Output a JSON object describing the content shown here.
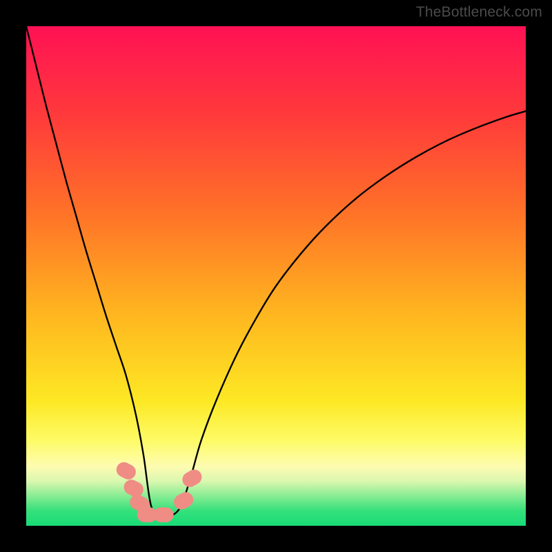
{
  "watermark": "TheBottleneck.com",
  "chart_data": {
    "type": "line",
    "title": "",
    "xlabel": "",
    "ylabel": "",
    "xlim": [
      0,
      100
    ],
    "ylim": [
      0,
      100
    ],
    "grid": false,
    "legend": false,
    "background_gradient_top_to_bottom": [
      {
        "pos": 0.0,
        "color": "#ff1154"
      },
      {
        "pos": 0.18,
        "color": "#ff3a3b"
      },
      {
        "pos": 0.38,
        "color": "#ff7427"
      },
      {
        "pos": 0.58,
        "color": "#ffb71f"
      },
      {
        "pos": 0.75,
        "color": "#fde824"
      },
      {
        "pos": 0.83,
        "color": "#fdfb66"
      },
      {
        "pos": 0.88,
        "color": "#fefcb0"
      },
      {
        "pos": 0.91,
        "color": "#dcf7b0"
      },
      {
        "pos": 0.94,
        "color": "#88ed93"
      },
      {
        "pos": 0.97,
        "color": "#35e07b"
      },
      {
        "pos": 1.0,
        "color": "#18db76"
      }
    ],
    "series": [
      {
        "name": "bottleneck-curve",
        "color": "#000000",
        "width": 2.4,
        "x": [
          0,
          2,
          4,
          6,
          8,
          10,
          12,
          14,
          16,
          18,
          20,
          22,
          23.5,
          25,
          27,
          29,
          31,
          33,
          35,
          38,
          42,
          46,
          50,
          55,
          60,
          66,
          72,
          78,
          84,
          90,
          96,
          100
        ],
        "values": [
          100,
          92,
          84,
          76.5,
          69,
          62,
          55,
          48.5,
          42,
          36,
          30,
          22,
          14,
          4,
          2,
          2,
          4,
          10,
          17,
          25,
          34,
          41.5,
          48,
          54.5,
          60,
          65.5,
          70,
          73.8,
          77,
          79.6,
          81.8,
          83
        ]
      }
    ],
    "markers": {
      "name": "bottom-highlight-dots",
      "shape": "rounded-pill",
      "color": "#ef8d85",
      "points": [
        {
          "x": 20.0,
          "y": 11.0,
          "w": 3.0,
          "h": 4.0,
          "angle": -63
        },
        {
          "x": 21.5,
          "y": 7.5,
          "w": 3.0,
          "h": 4.0,
          "angle": -63
        },
        {
          "x": 22.7,
          "y": 4.5,
          "w": 3.0,
          "h": 4.0,
          "angle": -63
        },
        {
          "x": 24.2,
          "y": 2.2,
          "w": 4.0,
          "h": 3.0,
          "angle": 0
        },
        {
          "x": 27.5,
          "y": 2.2,
          "w": 4.0,
          "h": 3.0,
          "angle": 0
        },
        {
          "x": 31.5,
          "y": 5.0,
          "w": 3.0,
          "h": 4.0,
          "angle": 62
        },
        {
          "x": 33.2,
          "y": 9.5,
          "w": 3.0,
          "h": 4.0,
          "angle": 60
        }
      ]
    }
  }
}
